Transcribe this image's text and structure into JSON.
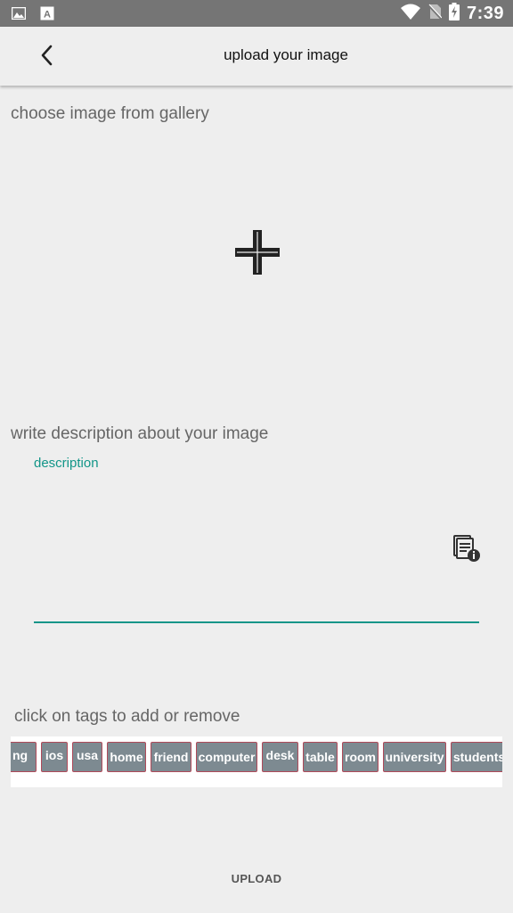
{
  "status_bar": {
    "time": "7:39",
    "icons": [
      "image-icon",
      "a-text-icon",
      "wifi-icon",
      "no-sim-icon",
      "battery-charging-icon"
    ]
  },
  "app_bar": {
    "title": "upload your image",
    "back_icon": "arrow-back-icon"
  },
  "gallery": {
    "label": "choose image from gallery",
    "add_icon": "plus-icon"
  },
  "description": {
    "label": "write description about your image",
    "field_label": "description",
    "value": "",
    "trailing_icon": "document-info-icon",
    "accent_color": "#129588"
  },
  "tags": {
    "label": "click on tags to add or remove",
    "items": [
      "ng",
      "ios",
      "usa",
      "home",
      "friend",
      "computer",
      "desk",
      "table",
      "room",
      "university",
      "students"
    ],
    "chip_color": "#7d8a91",
    "chip_border": "#b04a5a"
  },
  "actions": {
    "upload_label": "UPLOAD"
  }
}
